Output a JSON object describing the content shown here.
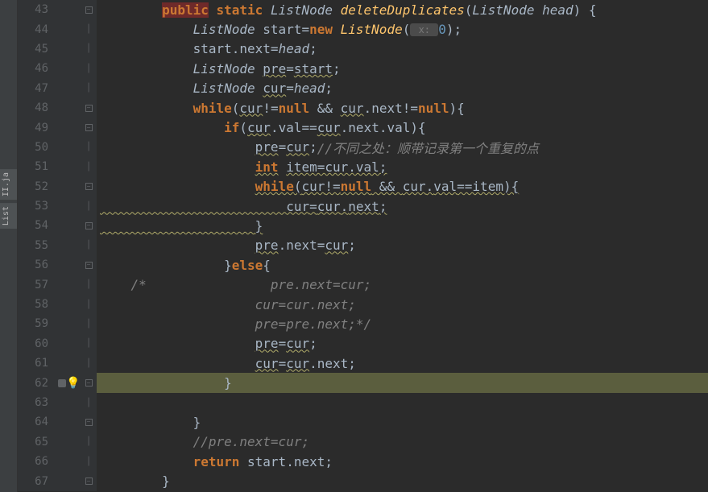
{
  "tabs": {
    "file1": "II.ja",
    "file2": "List"
  },
  "lines": [
    {
      "n": 43,
      "fold": "╒─",
      "c": [
        {
          "t": "        ",
          "cl": ""
        },
        {
          "t": "public",
          "cl": "pub"
        },
        {
          "t": " ",
          "cl": ""
        },
        {
          "t": "static",
          "cl": "kw"
        },
        {
          "t": " ",
          "cl": ""
        },
        {
          "t": "ListNode",
          "cl": "type"
        },
        {
          "t": " ",
          "cl": ""
        },
        {
          "t": "deleteDuplicates",
          "cl": "method"
        },
        {
          "t": "(",
          "cl": "op"
        },
        {
          "t": "ListNode head",
          "cl": "param"
        },
        {
          "t": ") {",
          "cl": "op"
        }
      ]
    },
    {
      "n": 44,
      "fold": "│",
      "c": [
        {
          "t": "            ",
          "cl": ""
        },
        {
          "t": "ListNode",
          "cl": "type"
        },
        {
          "t": " start=",
          "cl": "var"
        },
        {
          "t": "new",
          "cl": "kw"
        },
        {
          "t": " ",
          "cl": ""
        },
        {
          "t": "ListNode",
          "cl": "method"
        },
        {
          "t": "(",
          "cl": "op"
        },
        {
          "t": " x: ",
          "cl": "hint"
        },
        {
          "t": "0",
          "cl": "num"
        },
        {
          "t": ");",
          "cl": "op"
        }
      ]
    },
    {
      "n": 45,
      "fold": "│",
      "c": [
        {
          "t": "            start.",
          "cl": "var"
        },
        {
          "t": "next",
          "cl": "var"
        },
        {
          "t": "=",
          "cl": "op"
        },
        {
          "t": "head",
          "cl": "param"
        },
        {
          "t": ";",
          "cl": "op"
        }
      ]
    },
    {
      "n": 46,
      "fold": "│",
      "c": [
        {
          "t": "            ",
          "cl": ""
        },
        {
          "t": "ListNode",
          "cl": "type"
        },
        {
          "t": " ",
          "cl": ""
        },
        {
          "t": "pre",
          "cl": "wavy"
        },
        {
          "t": "=",
          "cl": "op"
        },
        {
          "t": "start",
          "cl": "wavy"
        },
        {
          "t": ";",
          "cl": "op"
        }
      ]
    },
    {
      "n": 47,
      "fold": "│",
      "c": [
        {
          "t": "            ",
          "cl": ""
        },
        {
          "t": "ListNode",
          "cl": "type"
        },
        {
          "t": " ",
          "cl": ""
        },
        {
          "t": "cur",
          "cl": "wavy"
        },
        {
          "t": "=",
          "cl": "op"
        },
        {
          "t": "head",
          "cl": "param"
        },
        {
          "t": ";",
          "cl": "op"
        }
      ]
    },
    {
      "n": 48,
      "fold": "╒",
      "c": [
        {
          "t": "            ",
          "cl": ""
        },
        {
          "t": "while",
          "cl": "kw"
        },
        {
          "t": "(",
          "cl": "op"
        },
        {
          "t": "cur",
          "cl": "wavy"
        },
        {
          "t": "!=",
          "cl": "op"
        },
        {
          "t": "null",
          "cl": "kw"
        },
        {
          "t": " && ",
          "cl": "op"
        },
        {
          "t": "cur",
          "cl": "wavy"
        },
        {
          "t": ".",
          "cl": "op"
        },
        {
          "t": "next",
          "cl": "var"
        },
        {
          "t": "!=",
          "cl": "op"
        },
        {
          "t": "null",
          "cl": "kw"
        },
        {
          "t": "){",
          "cl": "op"
        }
      ]
    },
    {
      "n": 49,
      "fold": "╒",
      "c": [
        {
          "t": "                ",
          "cl": ""
        },
        {
          "t": "if",
          "cl": "kw"
        },
        {
          "t": "(",
          "cl": "op"
        },
        {
          "t": "cur",
          "cl": "wavy"
        },
        {
          "t": ".",
          "cl": "op"
        },
        {
          "t": "val",
          "cl": "var"
        },
        {
          "t": "==",
          "cl": "op"
        },
        {
          "t": "cur",
          "cl": "wavy"
        },
        {
          "t": ".",
          "cl": "op"
        },
        {
          "t": "next",
          "cl": "var"
        },
        {
          "t": ".",
          "cl": "op"
        },
        {
          "t": "val",
          "cl": "var"
        },
        {
          "t": "){",
          "cl": "op"
        }
      ]
    },
    {
      "n": 50,
      "fold": "│",
      "c": [
        {
          "t": "                    ",
          "cl": ""
        },
        {
          "t": "pre",
          "cl": "wavy"
        },
        {
          "t": "=",
          "cl": "op"
        },
        {
          "t": "cur",
          "cl": "wavy"
        },
        {
          "t": ";",
          "cl": "op"
        },
        {
          "t": "//不同之处：顺带记录第一个重复的点",
          "cl": "comment"
        }
      ]
    },
    {
      "n": 51,
      "fold": "│",
      "c": [
        {
          "t": "                    ",
          "cl": ""
        },
        {
          "t": "int",
          "cl": "kw wavy"
        },
        {
          "t": " ",
          "cl": ""
        },
        {
          "t": "item=cur.val;",
          "cl": "wavy"
        }
      ]
    },
    {
      "n": 52,
      "fold": "╒",
      "c": [
        {
          "t": "                    ",
          "cl": ""
        },
        {
          "t": "while",
          "cl": "kw wavy"
        },
        {
          "t": "(",
          "cl": "wavy"
        },
        {
          "t": "cur",
          "cl": "wavy"
        },
        {
          "t": "!=",
          "cl": "wavy"
        },
        {
          "t": "null",
          "cl": "kw wavy"
        },
        {
          "t": " && ",
          "cl": "wavy"
        },
        {
          "t": "cur",
          "cl": "wavy"
        },
        {
          "t": ".",
          "cl": "wavy"
        },
        {
          "t": "val",
          "cl": "wavy"
        },
        {
          "t": "==item){",
          "cl": "wavy"
        }
      ]
    },
    {
      "n": 53,
      "fold": "│",
      "c": [
        {
          "t": "                        ",
          "cl": "wavy"
        },
        {
          "t": "cur",
          "cl": "wavy"
        },
        {
          "t": "=",
          "cl": "wavy"
        },
        {
          "t": "cur",
          "cl": "wavy"
        },
        {
          "t": ".",
          "cl": "wavy"
        },
        {
          "t": "next",
          "cl": "wavy"
        },
        {
          "t": ";",
          "cl": "wavy"
        }
      ]
    },
    {
      "n": 54,
      "fold": "╘",
      "c": [
        {
          "t": "                    ",
          "cl": "wavy"
        },
        {
          "t": "}",
          "cl": "wavy"
        }
      ]
    },
    {
      "n": 55,
      "fold": "│",
      "c": [
        {
          "t": "                    ",
          "cl": ""
        },
        {
          "t": "pre",
          "cl": "wavy"
        },
        {
          "t": ".",
          "cl": "op"
        },
        {
          "t": "next",
          "cl": "var"
        },
        {
          "t": "=",
          "cl": "op"
        },
        {
          "t": "cur",
          "cl": "wavy"
        },
        {
          "t": ";",
          "cl": "op"
        }
      ]
    },
    {
      "n": 56,
      "fold": "╞",
      "c": [
        {
          "t": "                }",
          "cl": "op"
        },
        {
          "t": "else",
          "cl": "kw"
        },
        {
          "t": "{",
          "cl": "op"
        }
      ]
    },
    {
      "n": 57,
      "fold": "│",
      "c": [
        {
          "t": "    ",
          "cl": ""
        },
        {
          "t": "/*",
          "cl": "comment"
        },
        {
          "t": "                pre.next=cur;",
          "cl": "comment"
        }
      ]
    },
    {
      "n": 58,
      "fold": "│",
      "c": [
        {
          "t": "                    cur=cur.next;",
          "cl": "comment"
        }
      ]
    },
    {
      "n": 59,
      "fold": "│",
      "c": [
        {
          "t": "                    pre=pre.next;*/",
          "cl": "comment"
        }
      ]
    },
    {
      "n": 60,
      "fold": "│",
      "c": [
        {
          "t": "                    ",
          "cl": ""
        },
        {
          "t": "pre",
          "cl": "wavy"
        },
        {
          "t": "=",
          "cl": "op"
        },
        {
          "t": "cur",
          "cl": "wavy"
        },
        {
          "t": ";",
          "cl": "op"
        }
      ]
    },
    {
      "n": 61,
      "fold": "│",
      "c": [
        {
          "t": "                    ",
          "cl": ""
        },
        {
          "t": "cur",
          "cl": "wavy"
        },
        {
          "t": "=",
          "cl": "op"
        },
        {
          "t": "cur",
          "cl": "wavy"
        },
        {
          "t": ".",
          "cl": "op"
        },
        {
          "t": "next",
          "cl": "var"
        },
        {
          "t": ";",
          "cl": "op"
        }
      ]
    },
    {
      "n": 62,
      "fold": "╘",
      "hl": true,
      "icon": "bulb",
      "bp": true,
      "c": [
        {
          "t": "                }",
          "cl": "op"
        }
      ]
    },
    {
      "n": 63,
      "fold": "│",
      "c": [
        {
          "t": "",
          "cl": ""
        }
      ]
    },
    {
      "n": 64,
      "fold": "╘",
      "c": [
        {
          "t": "            }",
          "cl": "op"
        }
      ]
    },
    {
      "n": 65,
      "fold": "│",
      "c": [
        {
          "t": "            ",
          "cl": ""
        },
        {
          "t": "//pre.next=cur;",
          "cl": "comment"
        }
      ]
    },
    {
      "n": 66,
      "fold": "│",
      "c": [
        {
          "t": "            ",
          "cl": ""
        },
        {
          "t": "return",
          "cl": "kw"
        },
        {
          "t": " start.",
          "cl": "var"
        },
        {
          "t": "next",
          "cl": "var"
        },
        {
          "t": ";",
          "cl": "op"
        }
      ]
    },
    {
      "n": 67,
      "fold": "╘",
      "c": [
        {
          "t": "        }",
          "cl": "op"
        }
      ]
    }
  ]
}
